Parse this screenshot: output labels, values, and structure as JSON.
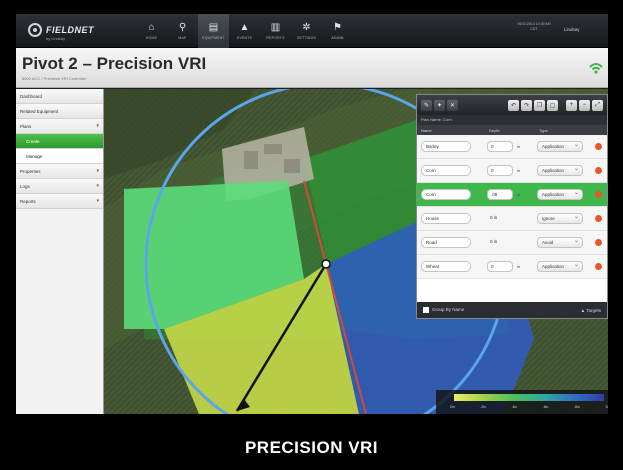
{
  "app": {
    "logo_text": "FIELDNET",
    "logo_sub": "by Lindsay",
    "datetime": "06/11/2014 10:39 AM CDT",
    "user": "Lindsay"
  },
  "nav": [
    {
      "label": "HOME",
      "icon": "home-icon",
      "glyph": "⌂"
    },
    {
      "label": "MAP",
      "icon": "map-pin-icon",
      "glyph": "⚲"
    },
    {
      "label": "EQUIPMENT",
      "icon": "equipment-icon",
      "glyph": "▤"
    },
    {
      "label": "EVENTS",
      "icon": "events-icon",
      "glyph": "▲"
    },
    {
      "label": "REPORTS",
      "icon": "reports-icon",
      "glyph": "▥"
    },
    {
      "label": "SETTINGS",
      "icon": "gear-icon",
      "glyph": "✲"
    },
    {
      "label": "ADMIN",
      "icon": "admin-icon",
      "glyph": "⚑"
    }
  ],
  "page": {
    "title": "Pivot 2 – Precision VRI",
    "subtitle": "8000 ACC / Precision VRI Controller"
  },
  "sidebar": [
    {
      "label": "Dashboard",
      "chevron": false,
      "sub": false,
      "active": false
    },
    {
      "label": "Related Equipment",
      "chevron": false,
      "sub": false,
      "active": false
    },
    {
      "label": "Plans",
      "chevron": true,
      "sub": false,
      "active": false
    },
    {
      "label": "Create",
      "chevron": false,
      "sub": true,
      "active": true
    },
    {
      "label": "Manage",
      "chevron": false,
      "sub": true,
      "active": false
    },
    {
      "label": "Properties",
      "chevron": true,
      "sub": false,
      "active": false
    },
    {
      "label": "Logs",
      "chevron": true,
      "sub": false,
      "active": false
    },
    {
      "label": "Reports",
      "chevron": true,
      "sub": false,
      "active": false
    }
  ],
  "panel": {
    "plan_name": "Plan Name: Corn",
    "columns": [
      "Name",
      "Depth",
      "Type"
    ],
    "rows": [
      {
        "name": "Barley",
        "depth": "0",
        "unit": "in",
        "type": "Application",
        "depth_input": true,
        "selected": false
      },
      {
        "name": "Corn",
        "depth": "0",
        "unit": "in",
        "type": "Application",
        "depth_input": true,
        "selected": false
      },
      {
        "name": "Corn",
        "depth": ".08",
        "unit": "in",
        "type": "Application",
        "depth_input": true,
        "selected": true
      },
      {
        "name": "House",
        "depth": "0 in",
        "unit": "",
        "type": "Ignore",
        "depth_input": false,
        "selected": false
      },
      {
        "name": "Road",
        "depth": "0 in",
        "unit": "",
        "type": "Avoid",
        "depth_input": false,
        "selected": false
      },
      {
        "name": "Wheat",
        "depth": "0",
        "unit": "in",
        "type": "Application",
        "depth_input": true,
        "selected": false
      }
    ],
    "footer_left": "Group By Name",
    "footer_right": "Targets"
  },
  "legend": {
    "ticks": [
      "0in",
      ".2in",
      ".4in",
      ".6in",
      ".8in",
      "1in"
    ]
  },
  "caption": "PRECISION VRI"
}
